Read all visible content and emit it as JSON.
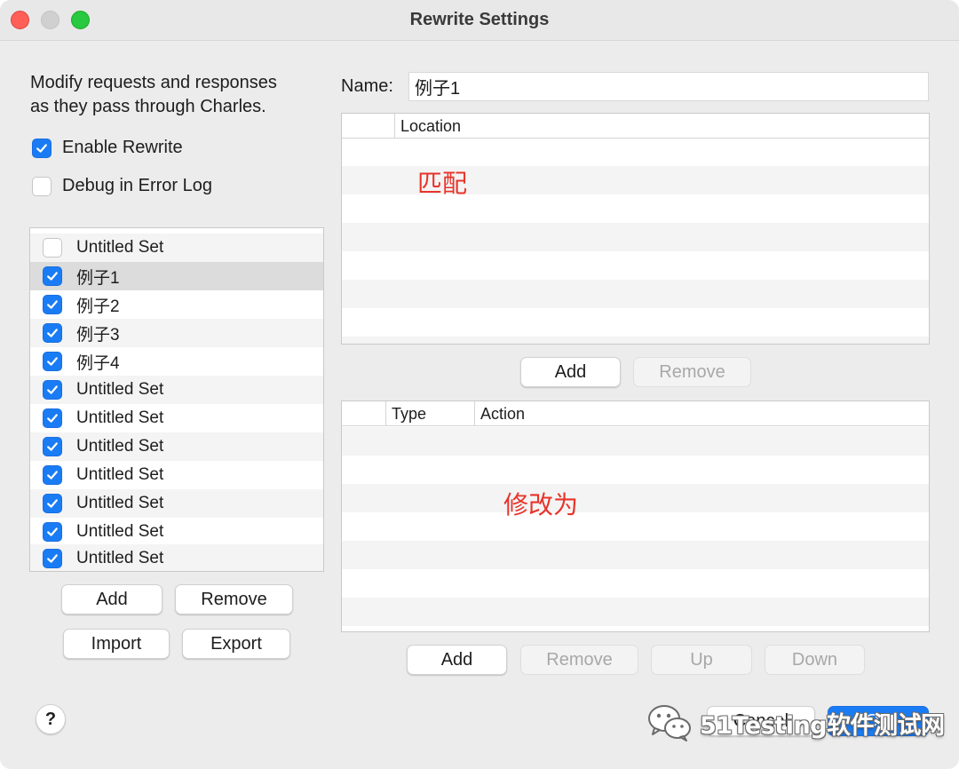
{
  "window": {
    "title": "Rewrite Settings"
  },
  "left": {
    "description_line1": "Modify requests and responses",
    "description_line2": "as they pass through Charles.",
    "enable_rewrite": {
      "label": "Enable Rewrite",
      "checked": true
    },
    "debug_log": {
      "label": "Debug in Error Log",
      "checked": false
    },
    "sets": [
      {
        "label": "Untitled Set",
        "checked": false,
        "selected": false
      },
      {
        "label": "例子1",
        "checked": true,
        "selected": true
      },
      {
        "label": "例子2",
        "checked": true,
        "selected": false
      },
      {
        "label": "例子3",
        "checked": true,
        "selected": false
      },
      {
        "label": "例子4",
        "checked": true,
        "selected": false
      },
      {
        "label": "Untitled Set",
        "checked": true,
        "selected": false
      },
      {
        "label": "Untitled Set",
        "checked": true,
        "selected": false
      },
      {
        "label": "Untitled Set",
        "checked": true,
        "selected": false
      },
      {
        "label": "Untitled Set",
        "checked": true,
        "selected": false
      },
      {
        "label": "Untitled Set",
        "checked": true,
        "selected": false
      },
      {
        "label": "Untitled Set",
        "checked": true,
        "selected": false
      },
      {
        "label": "Untitled Set",
        "checked": true,
        "selected": false
      }
    ],
    "buttons": {
      "add": "Add",
      "remove": "Remove",
      "import": "Import",
      "export": "Export"
    }
  },
  "right": {
    "name_label": "Name:",
    "name_value": "例子1",
    "location_table": {
      "header": "Location",
      "annotation": "匹配",
      "add": "Add",
      "remove": "Remove"
    },
    "rules_table": {
      "header_type": "Type",
      "header_action": "Action",
      "annotation": "修改为",
      "add": "Add",
      "remove": "Remove",
      "up": "Up",
      "down": "Down"
    }
  },
  "footer": {
    "help": "?",
    "cancel": "Cancel",
    "ok": "OK",
    "watermark": "51Testing软件测试网"
  },
  "colors": {
    "accent": "#1a7cf5",
    "annotation": "#e8332a"
  }
}
